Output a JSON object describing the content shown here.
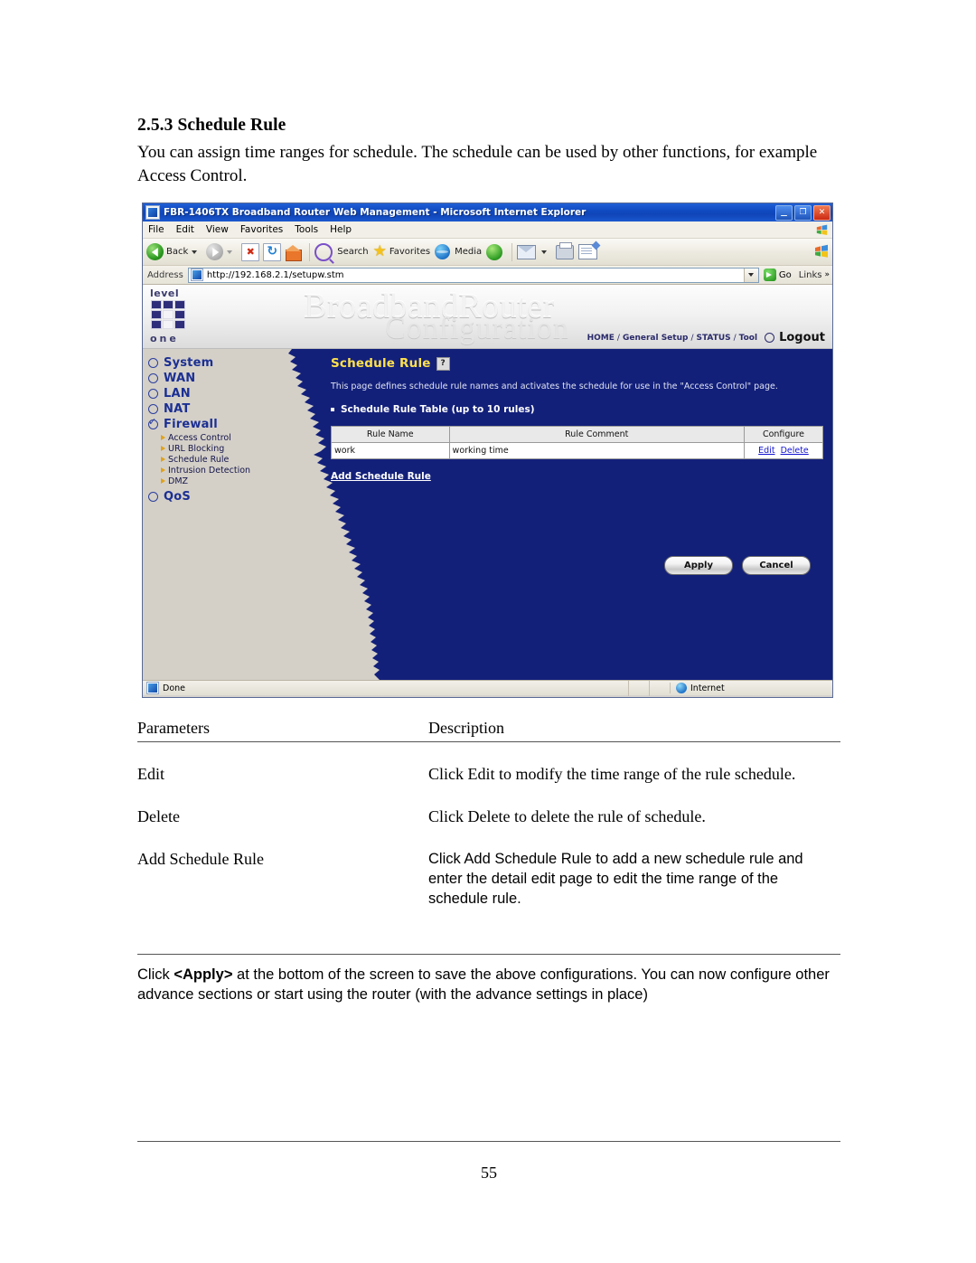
{
  "document": {
    "heading": "2.5.3 Schedule Rule",
    "intro": "You can assign time ranges for schedule. The schedule can be used by other functions, for example Access Control.",
    "page_number": "55"
  },
  "browser": {
    "window_title": "FBR-1406TX Broadband Router Web Management - Microsoft Internet Explorer",
    "menus": [
      "File",
      "Edit",
      "View",
      "Favorites",
      "Tools",
      "Help"
    ],
    "toolbar": {
      "back_label": "Back",
      "search_label": "Search",
      "favorites_label": "Favorites",
      "media_label": "Media"
    },
    "address": {
      "label": "Address",
      "url": "http://192.168.2.1/setupw.stm",
      "go_label": "Go",
      "links_label": "Links"
    },
    "window_buttons": {
      "minimize": "_",
      "restore": "❐",
      "close": "✕"
    },
    "status": {
      "text": "Done",
      "zone": "Internet"
    }
  },
  "router_ui": {
    "logo": {
      "top_text": "level",
      "bottom_text": "one"
    },
    "banner_title": "BroadbandRouter",
    "banner_subtitle": "Configuration",
    "top_nav": {
      "items": [
        "HOME",
        "General Setup",
        "STATUS",
        "Tool"
      ],
      "separator": "/",
      "logout_label": "Logout"
    },
    "sidebar": {
      "items": [
        {
          "label": "System",
          "selected": false
        },
        {
          "label": "WAN",
          "selected": false
        },
        {
          "label": "LAN",
          "selected": false
        },
        {
          "label": "NAT",
          "selected": false
        },
        {
          "label": "Firewall",
          "selected": true
        },
        {
          "label": "QoS",
          "selected": false
        }
      ],
      "sub_items": [
        "Access Control",
        "URL Blocking",
        "Schedule Rule",
        "Intrusion Detection",
        "DMZ"
      ]
    },
    "panel": {
      "title": "Schedule Rule",
      "help_icon_label": "?",
      "description": "This page defines schedule rule names and activates the schedule for use in the \"Access Control\" page.",
      "section_label": "Schedule Rule Table (up to 10 rules)",
      "table": {
        "columns": [
          "Rule Name",
          "Rule Comment",
          "Configure"
        ],
        "rows": [
          {
            "rule_name": "work",
            "rule_comment": "working time",
            "edit_label": "Edit",
            "delete_label": "Delete"
          }
        ]
      },
      "add_link": "Add Schedule Rule",
      "apply_label": "Apply",
      "cancel_label": "Cancel"
    },
    "colors": {
      "panel_navy": "#13207a",
      "title_yellow": "#ffe14d",
      "sidebar_gray": "#d4d0c8",
      "link_blue": "#1414d0"
    }
  },
  "parameters_table": {
    "header": {
      "parameters": "Parameters",
      "description": "Description"
    },
    "rows": [
      {
        "name": "Edit",
        "description": "Click Edit to modify the time range of the rule schedule."
      },
      {
        "name": "Delete",
        "description": "Click Delete to delete the rule of schedule."
      },
      {
        "name": "Add Schedule Rule",
        "description": "Click Add Schedule Rule to add a new schedule rule and enter the detail edit page to edit the time range of the schedule rule."
      }
    ]
  },
  "footnote": {
    "prefix": "Click ",
    "bold": "<Apply>",
    "suffix": " at the bottom of the screen to save the above configurations. You can now configure other advance sections or start using the router (with the advance settings in place)"
  }
}
